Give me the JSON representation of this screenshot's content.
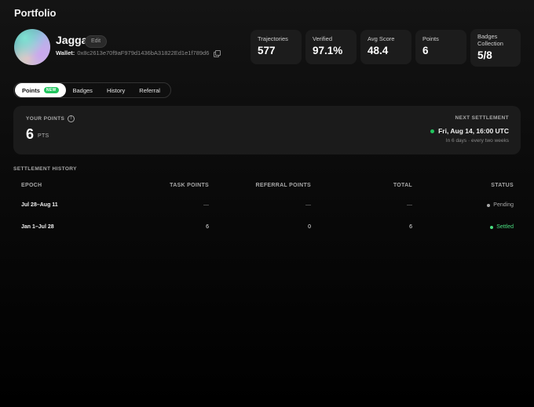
{
  "header": {
    "title": "Portfolio"
  },
  "profile": {
    "name": "Jagga",
    "edit_label": "Edit",
    "wallet_label": "Wallet:",
    "wallet_address": "0x8c2613e70f9aF979d1436bA31822Ed1e1f789d6"
  },
  "stats": [
    {
      "label": "Trajectories",
      "value": "577"
    },
    {
      "label": "Verified",
      "value": "97.1%"
    },
    {
      "label": "Avg Score",
      "value": "48.4"
    },
    {
      "label": "Points",
      "value": "6"
    },
    {
      "label_line1": "Badges",
      "label_line2": "Collection",
      "value": "5/8"
    }
  ],
  "tabs": [
    {
      "label": "Points",
      "badge": "NEW",
      "active": true
    },
    {
      "label": "Badges"
    },
    {
      "label": "History"
    },
    {
      "label": "Referral"
    }
  ],
  "points_panel": {
    "label": "YOUR POINTS",
    "value": "6",
    "unit": "PTS",
    "settlement_label": "NEXT SETTLEMENT",
    "settlement_date": "Fri, Aug 14, 16:00 UTC",
    "settlement_sub": "In 6 days · every two weeks"
  },
  "history": {
    "heading": "SETTLEMENT HISTORY",
    "columns": [
      "EPOCH",
      "TASK POINTS",
      "REFERRAL POINTS",
      "TOTAL",
      "STATUS"
    ],
    "rows": [
      {
        "epoch": "Jul 28–Aug 11",
        "task": "—",
        "referral": "—",
        "total": "—",
        "status": "Pending"
      },
      {
        "epoch": "Jan 1–Jul 28",
        "task": "6",
        "referral": "0",
        "total": "6",
        "status": "Settled"
      }
    ]
  },
  "colors": {
    "accent_green": "#22c55e",
    "settled_green": "#4ade80",
    "pending_gray": "#a8a8a8",
    "background": "#0b0b0b"
  }
}
